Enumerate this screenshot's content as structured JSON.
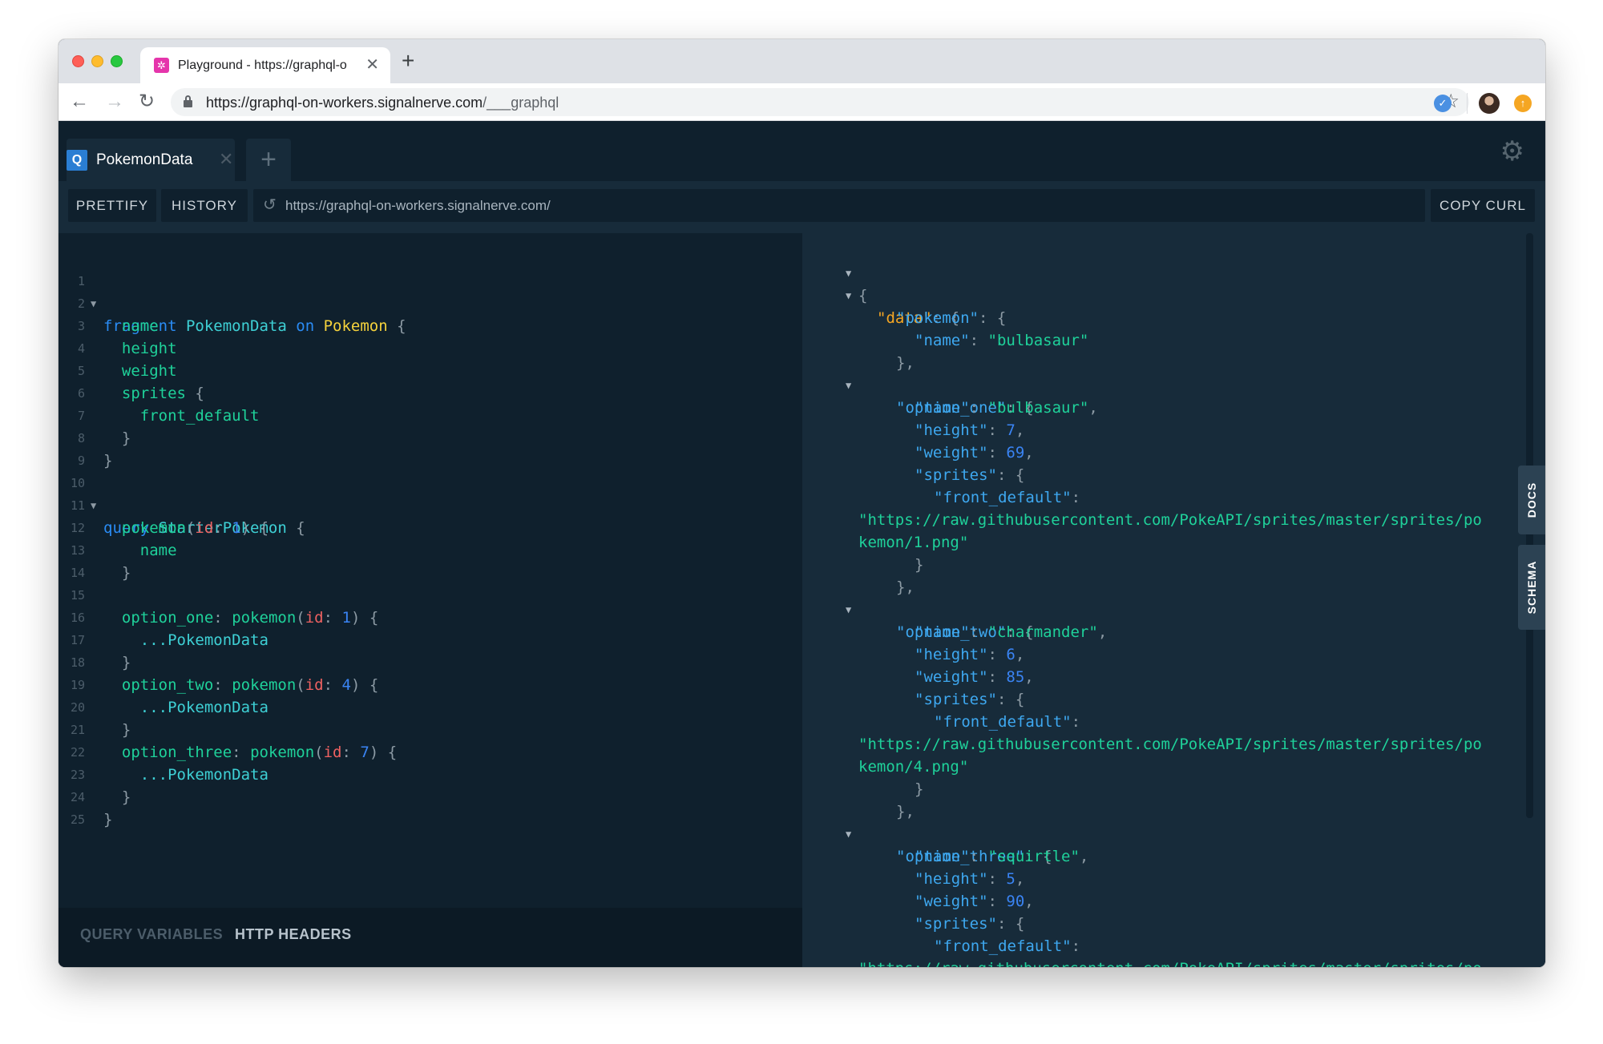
{
  "browser": {
    "tab_title": "Playground - https://graphql-o",
    "tab_close": "✕",
    "new_tab": "+",
    "url_host": "https://graphql-on-workers.signalnerve.com",
    "url_path": "/___graphql"
  },
  "playground": {
    "tab": {
      "badge": "Q",
      "label": "PokemonData",
      "close": "✕"
    },
    "new_tab": "+",
    "buttons": {
      "prettify": "PRETTIFY",
      "history": "HISTORY",
      "copy_curl": "COPY CURL"
    },
    "endpoint": "https://graphql-on-workers.signalnerve.com/",
    "bottom_tabs": {
      "query_variables": "QUERY VARIABLES",
      "http_headers": "HTTP HEADERS"
    },
    "side_tabs": {
      "docs": "DOCS",
      "schema": "SCHEMA"
    }
  },
  "editor": {
    "lines": [
      "1",
      "2",
      "3",
      "4",
      "5",
      "6",
      "7",
      "8",
      "9",
      "10",
      "11",
      "12",
      "13",
      "14",
      "15",
      "16",
      "17",
      "18",
      "19",
      "20",
      "21",
      "22",
      "23",
      "24",
      "25"
    ],
    "tokens": {
      "fragment": "fragment",
      "PokemonData": "PokemonData",
      "on": "on",
      "Pokemon": "Pokemon",
      "open": "{",
      "close": "}",
      "name": "name",
      "height": "height",
      "weight": "weight",
      "sprites": "sprites",
      "front_default": "front_default",
      "query": "query",
      "StarterPokemon": "StarterPokemon",
      "pokemon": "pokemon",
      "lparen": "(",
      "rparen": ")",
      "id": "id",
      "colon": ":",
      "one": "1",
      "four": "4",
      "seven": "7",
      "option_one": "option_one",
      "option_two": "option_two",
      "option_three": "option_three",
      "spread": "...PokemonData"
    }
  },
  "result": {
    "data_key": "\"data\"",
    "pokemon_key": "\"pokemon\"",
    "name_key": "\"name\"",
    "height_key": "\"height\"",
    "weight_key": "\"weight\"",
    "sprites_key": "\"sprites\"",
    "front_default_key": "\"front_default\"",
    "option_one_key": "\"option_one\"",
    "option_two_key": "\"option_two\"",
    "option_three_key": "\"option_three\"",
    "bulbasaur": "\"bulbasaur\"",
    "charmander": "\"charmander\"",
    "squirtle": "\"squirtle\"",
    "h1": "7",
    "w1": "69",
    "h2": "6",
    "w2": "85",
    "h3": "5",
    "w3": "90",
    "url_prefix": "\"https://raw.githubusercontent.com/PokeAPI/sprites/master/sprites/po",
    "url_1": "kemon/1.png\"",
    "url_4": "kemon/4.png\"",
    "url_partial": "\"https://raw.githubusercontent.com/PokeAPI/sprites/master/sprites/po"
  },
  "colors": {
    "editor_bg": "#0f202d",
    "result_bg": "#172b3a",
    "keyword": "#2a8cf5",
    "property": "#1fd19a",
    "type": "#f5d23c",
    "argument": "#ee6161",
    "data_key": "#f5a623"
  },
  "icons": [
    "close-icon",
    "plus-icon",
    "back-arrow-icon",
    "forward-arrow-icon",
    "reload-icon",
    "lock-icon",
    "star-icon",
    "gear-icon",
    "refresh-icon",
    "fold-arrow-icon"
  ]
}
